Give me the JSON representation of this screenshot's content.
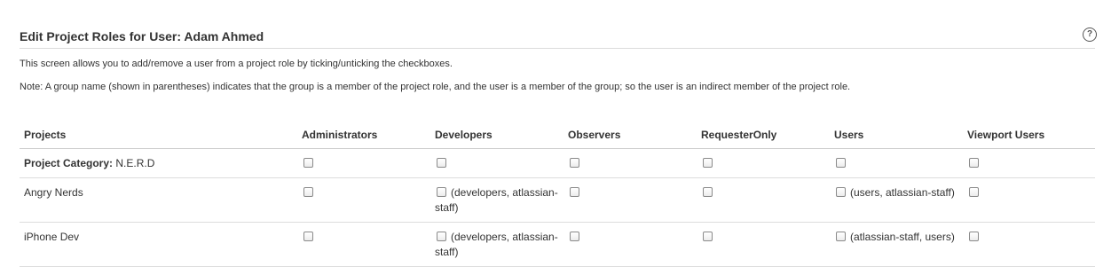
{
  "header": {
    "title": "Edit Project Roles for User: Adam Ahmed",
    "help_icon": "help-icon"
  },
  "descriptions": {
    "line1": "This screen allows you to add/remove a user from a project role by ticking/unticking the checkboxes.",
    "line2": "Note: A group name (shown in parentheses) indicates that the group is a member of the project role, and the user is a member of the group; so the user is an indirect member of the project role."
  },
  "table": {
    "columns": [
      "Projects",
      "Administrators",
      "Developers",
      "Observers",
      "RequesterOnly",
      "Users",
      "Viewport Users"
    ],
    "category": {
      "label": "Project Category:",
      "value": " N.E.R.D"
    },
    "rows": [
      {
        "name": "Angry Nerds",
        "cells": [
          "",
          "(developers, atlassian-staff)",
          "",
          "",
          "(users, atlassian-staff)",
          ""
        ]
      },
      {
        "name": "iPhone Dev",
        "cells": [
          "",
          "(developers, atlassian-staff)",
          "",
          "",
          "(atlassian-staff, users)",
          ""
        ]
      }
    ]
  }
}
